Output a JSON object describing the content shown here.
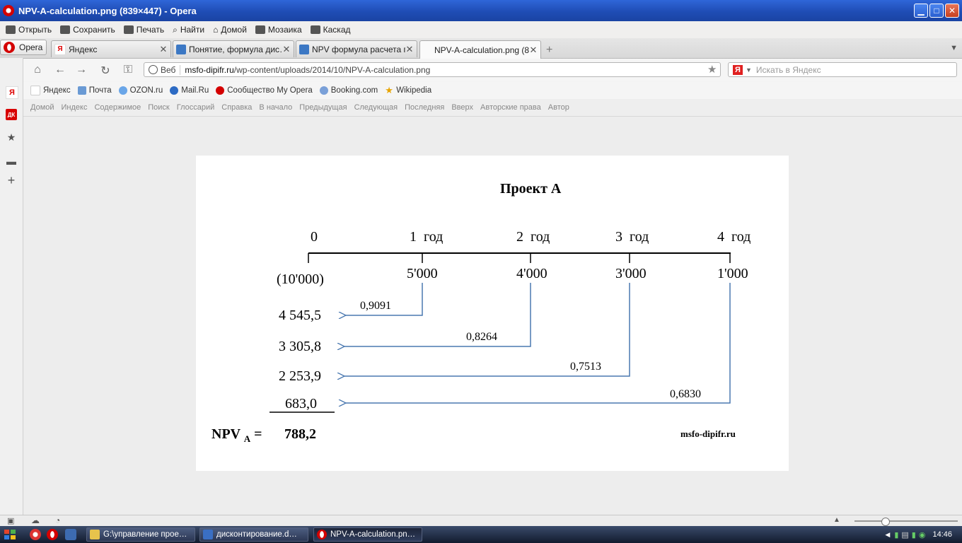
{
  "window": {
    "title": "NPV-A-calculation.png (839×447) - Opera"
  },
  "menu": [
    "Открыть",
    "Сохранить",
    "Печать",
    "Найти",
    "Домой",
    "Мозаика",
    "Каскад"
  ],
  "opera_button": "Opera",
  "tabs": [
    {
      "label": "Яндекс",
      "active": false
    },
    {
      "label": "Понятие, формула дис…",
      "active": false
    },
    {
      "label": "NPV формула расчета п…",
      "active": false
    },
    {
      "label": "NPV-A-calculation.png (8…",
      "active": true
    }
  ],
  "address": {
    "web_label": "Веб",
    "host": "msfo-dipifr.ru",
    "path": "/wp-content/uploads/2014/10/NPV-A-calculation.png"
  },
  "search": {
    "placeholder": "Искать в Яндекс"
  },
  "bookmarks": [
    "Яндекс",
    "Почта",
    "OZON.ru",
    "Mail.Ru",
    "Сообщество My Opera",
    "Booking.com",
    "Wikipedia"
  ],
  "linkbar": [
    "Домой",
    "Индекс",
    "Содержимое",
    "Поиск",
    "Глоссарий",
    "Справка",
    "В начало",
    "Предыдущая",
    "Следующая",
    "Последняя",
    "Вверх",
    "Авторские права",
    "Автор"
  ],
  "sidepanel": {
    "ya": "Я",
    "dk": "ДК"
  },
  "figure": {
    "title": "Проект А",
    "years": [
      "0",
      "1  год",
      "2  год",
      "3  год",
      "4  год"
    ],
    "cashflows": [
      "(10'000)",
      "5'000",
      "4'000",
      "3'000",
      "1'000"
    ],
    "factors": [
      "0,9091",
      "0,8264",
      "0,7513",
      "0,6830"
    ],
    "present_values": [
      "4 545,5",
      "3 305,8",
      "2 253,9",
      "683,0"
    ],
    "npv_label": "NPV",
    "npv_sub": "A",
    "npv_eq": "=",
    "npv_value": "788,2",
    "watermark": "msfo-dipifr.ru"
  },
  "taskbar": {
    "tasks": [
      {
        "label": "G:\\управление прое…"
      },
      {
        "label": "дисконтирование.d…"
      },
      {
        "label": "NPV-A-calculation.pn…"
      }
    ],
    "clock": "14:46"
  }
}
